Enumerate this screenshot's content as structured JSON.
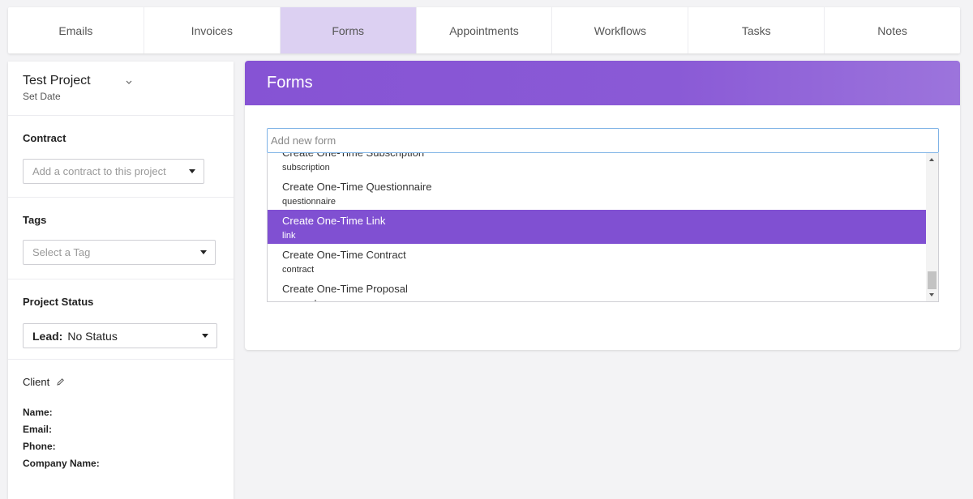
{
  "tabs": [
    {
      "label": "Emails",
      "active": false
    },
    {
      "label": "Invoices",
      "active": false
    },
    {
      "label": "Forms",
      "active": true
    },
    {
      "label": "Appointments",
      "active": false
    },
    {
      "label": "Workflows",
      "active": false
    },
    {
      "label": "Tasks",
      "active": false
    },
    {
      "label": "Notes",
      "active": false
    }
  ],
  "sidebar": {
    "project": {
      "name": "Test Project",
      "date": "Set Date"
    },
    "contract": {
      "label": "Contract",
      "placeholder": "Add a contract to this project"
    },
    "tags": {
      "label": "Tags",
      "placeholder": "Select a Tag"
    },
    "status": {
      "label": "Project Status",
      "prefix": "Lead:",
      "value": "No Status"
    },
    "client": {
      "label": "Client",
      "fields": [
        "Name:",
        "Email:",
        "Phone:",
        "Company Name:"
      ]
    }
  },
  "forms": {
    "title": "Forms",
    "input_placeholder": "Add new form",
    "options": [
      {
        "title": "Create One-Time Subscription",
        "sub": "subscription"
      },
      {
        "title": "Create One-Time Questionnaire",
        "sub": "questionnaire"
      },
      {
        "title": "Create One-Time Link",
        "sub": "link",
        "selected": true
      },
      {
        "title": "Create One-Time Contract",
        "sub": "contract"
      },
      {
        "title": "Create One-Time Proposal",
        "sub": "proposal"
      }
    ]
  },
  "colors": {
    "accent": "#8050d2",
    "tab_active": "#dcd0f2",
    "input_focus": "#7fb3e6"
  },
  "icons": {
    "project_toggle": "chevron-down-icon",
    "client_edit": "pencil-icon",
    "select": "caret-down-icon"
  }
}
